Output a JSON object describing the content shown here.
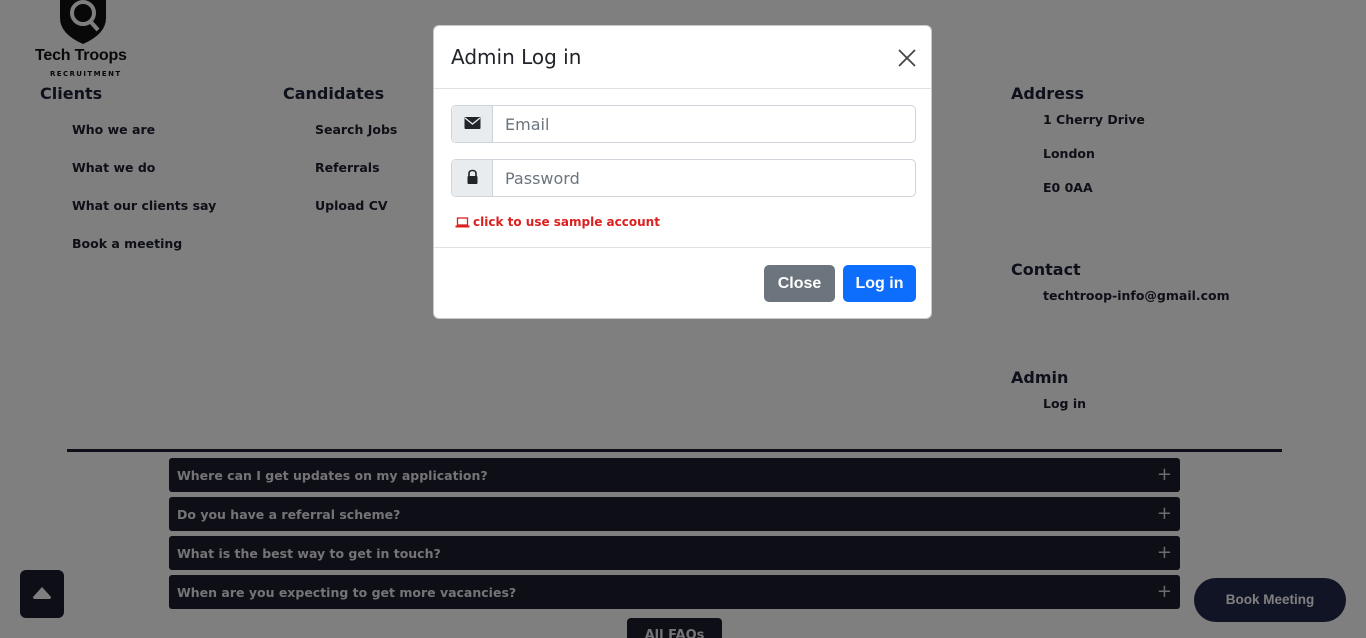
{
  "logo": {
    "title": "Tech Troops",
    "subtitle": "RECRUITMENT"
  },
  "footer": {
    "clients": {
      "title": "Clients",
      "links": [
        "Who we are",
        "What we do",
        "What our clients say",
        "Book a meeting"
      ]
    },
    "candidates": {
      "title": "Candidates",
      "links": [
        "Search Jobs",
        "Referrals",
        "Upload CV"
      ]
    },
    "address": {
      "title": "Address",
      "lines": [
        "1 Cherry Drive",
        "London",
        "E0 0AA"
      ]
    },
    "contact": {
      "title": "Contact",
      "email": "techtroop-info@gmail.com"
    },
    "admin": {
      "title": "Admin",
      "link": "Log in"
    }
  },
  "faq": {
    "items": [
      "Where can I get updates on my application?",
      "Do you have a referral scheme?",
      "What is the best way to get in touch?",
      "When are you expecting to get more vacancies?"
    ],
    "expand_icon": "+",
    "all_button": "All FAQs"
  },
  "book_meeting": "Book Meeting",
  "modal": {
    "title": "Admin Log in",
    "email_placeholder": "Email",
    "password_placeholder": "Password",
    "sample_link": "click to use sample account",
    "close_label": "Close",
    "login_label": "Log in"
  },
  "colors": {
    "primary": "#0d6efd",
    "secondary": "#6c757d",
    "danger": "#dc1f1f",
    "dark": "#1a1c2c"
  },
  "icons": [
    "envelope-icon",
    "lock-icon",
    "laptop-icon",
    "close-icon",
    "caret-up-icon",
    "plus-icon"
  ]
}
